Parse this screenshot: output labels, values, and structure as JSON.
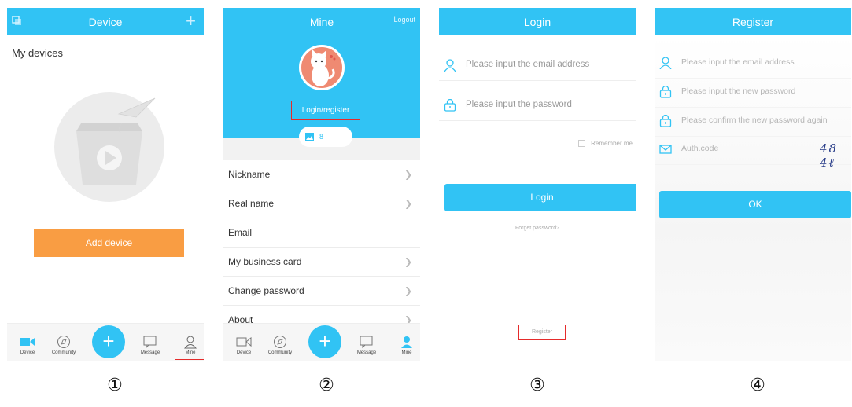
{
  "screens": {
    "device": {
      "title": "Device",
      "plus": "+",
      "section_title": "My devices",
      "add_device": "Add device",
      "fab": "+",
      "tabs": [
        "Device",
        "Community",
        "Message",
        "Mine"
      ]
    },
    "mine": {
      "title": "Mine",
      "logout": "Logout",
      "login_register": "Login/register",
      "photo_count": "8",
      "menu": [
        "Nickname",
        "Real name",
        "Email",
        "My business card",
        "Change password",
        "About"
      ],
      "fab": "+",
      "tabs": [
        "Device",
        "Community",
        "Message",
        "Mine"
      ]
    },
    "login": {
      "title": "Login",
      "email_placeholder": "Please input the email address",
      "password_placeholder": "Please input the password",
      "remember_me": "Remember me",
      "login_button": "Login",
      "forget_password": "Forget password?",
      "register": "Register"
    },
    "register": {
      "title": "Register",
      "email_placeholder": "Please input the email address",
      "new_password_placeholder": "Please input the new password",
      "confirm_password_placeholder": "Please confirm the new password again",
      "auth_code_placeholder": "Auth.code",
      "captcha": "48 4ℓ",
      "ok_button": "OK"
    }
  },
  "captions": [
    "①",
    "②",
    "③",
    "④"
  ],
  "colors": {
    "primary": "#31c3f4",
    "accent": "#f99d43",
    "highlight": "#e52b2b"
  },
  "icons": [
    "copy-icon",
    "plus-icon",
    "camera-icon",
    "compass-icon",
    "message-icon",
    "user-icon",
    "lock-icon",
    "mail-icon",
    "image-icon",
    "chevron-right-icon"
  ]
}
